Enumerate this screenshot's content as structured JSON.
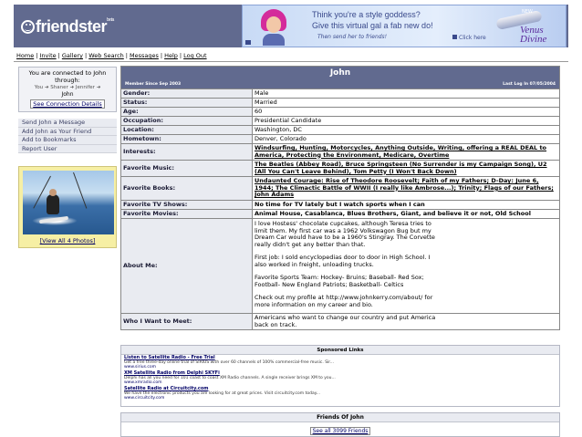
{
  "header": {
    "logo_text": "friendster",
    "logo_badge": "beta"
  },
  "ad": {
    "line1": "Think you're a style goddess?",
    "line2": "Give this virtual gal a fab new do!",
    "line3": "Then send her to friends!",
    "click": "Click here",
    "brand_top": "NEW",
    "brand_name": "Venus Divine"
  },
  "nav": [
    {
      "label": "Home"
    },
    {
      "label": "Invite"
    },
    {
      "label": "Gallery"
    },
    {
      "label": "Web Search"
    },
    {
      "label": "Messages"
    },
    {
      "label": "Help"
    },
    {
      "label": "Log Out"
    }
  ],
  "connection": {
    "title": "You are connected to John through:",
    "path": "You ➜ Shaner ➜ Jennifer ➜",
    "user": "John",
    "details_link": "See Connection Details"
  },
  "actions": [
    {
      "label": "Send John a Message"
    },
    {
      "label": "Add John as Your Friend"
    },
    {
      "label": "Add to Bookmarks"
    },
    {
      "label": "Report User"
    }
  ],
  "photo": {
    "view_all": "[View All 4 Photos]"
  },
  "profile": {
    "name": "John",
    "member_since": "Member Since Sep 2003",
    "last_login": "Last Log In 07/05/2004",
    "rows": {
      "gender": {
        "label": "Gender:",
        "value": "Male"
      },
      "status": {
        "label": "Status:",
        "value": "Married"
      },
      "age": {
        "label": "Age:",
        "value": "60"
      },
      "occupation": {
        "label": "Occupation:",
        "value": "Presidential Candidate"
      },
      "location": {
        "label": "Location:",
        "value": "Washington, DC"
      },
      "hometown": {
        "label": "Hometown:",
        "value": "Denver, Colorado"
      },
      "interests": {
        "label": "Interests:",
        "value": "Windsurfing, Hunting, Motorcycles, Anything Outside, Writing, offering a REAL DEAL to America, Protecting the Environment, Medicare, Overtime"
      },
      "music": {
        "label": "Favorite Music:",
        "value": "The Beatles (Abbey Road), Bruce Springsteen (No Surrender is my Campaign Song), U2 (All You Can't Leave Behind), Tom Petty (I Won't Back Down)"
      },
      "books": {
        "label": "Favorite Books:",
        "value": "Undaunted Courage: Rise of Theodore Roosevelt; Faith of my Fathers; D-Day: June 6, 1944; The Climactic Battle of WWII (I really like Ambrose...); Trinity; Flags of our Fathers; John Adams"
      },
      "tv": {
        "label": "Favorite TV Shows:",
        "value": "No time for TV lately but I watch sports when I can"
      },
      "movies": {
        "label": "Favorite Movies:",
        "value": "Animal House, Casablanca, Blues Brothers, Giant, and believe it or not, Old School"
      },
      "about": {
        "label": "About Me:",
        "p1": "I love Hostess' chocolate cupcakes, although Teresa tries to limit them. My first car was a 1962 Volkswagon Bug but my Dream Car would have to be a 1960's Stingray. The Corvette really didn't get any better than that.",
        "p2": "First job: I sold encyclopedias door to door in High School. I also worked in freight, unloading trucks.",
        "p3": "Favorite Sports Team: Hockey- Bruins; Baseball- Red Sox; Football- New England Patriots; Basketball- Celtics",
        "p4": "Check out my profile at http://www.johnkerry.com/about/ for more information on my career and bio."
      },
      "meet": {
        "label": "Who I Want to Meet:",
        "value": "Americans who want to change our country and put America back on track."
      }
    }
  },
  "sponsored": {
    "title": "Sponsored Links",
    "items": [
      {
        "head": "Listen to Satellite Radio - Free Trial",
        "desc": "Get a free three-day online trial of SIRIUS with over 60 channels of 100% commercial-free music. Sir...",
        "url": "www.sirius.com"
      },
      {
        "head": "XM Satellite Radio from Delphi SKYFi",
        "desc": "Delphi has all you need for 101 coast to coast XM Radio channels. A single receiver brings XM to you...",
        "url": "www.xmradio.com"
      },
      {
        "head": "Satellite Radio at Circuitcity.com",
        "desc": "We have the electronic products you are looking for at great prices. Visit circuitcity.com today...",
        "url": "www.circuitcity.com"
      }
    ]
  },
  "friends": {
    "title": "Friends Of John",
    "link": "See all 3099 Friends"
  }
}
